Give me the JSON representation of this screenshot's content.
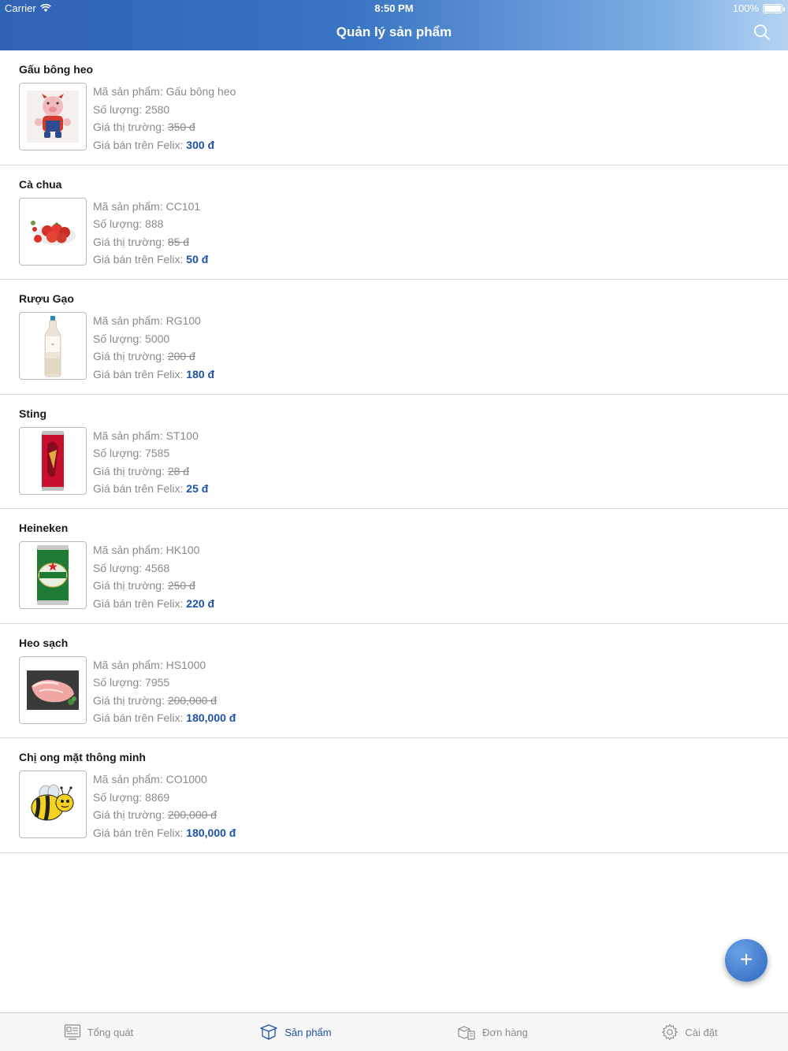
{
  "status_bar": {
    "carrier": "Carrier",
    "time": "8:50 PM",
    "battery": "100%"
  },
  "header": {
    "title": "Quản lý sản phẩm",
    "search_icon": "search-icon"
  },
  "labels": {
    "code": "Mã sản phẩm: ",
    "qty": "Số lượng: ",
    "market": "Giá thị trường: ",
    "felix": "Giá bán trên Felix: "
  },
  "products": [
    {
      "name": "Gấu bông heo",
      "code": "Gấu bông heo",
      "qty": "2580",
      "market_price": "350 đ",
      "felix_price": "300 đ",
      "image": "pig-plush-image"
    },
    {
      "name": "Cà chua",
      "code": "CC101",
      "qty": "888",
      "market_price": "85 đ",
      "felix_price": "50 đ",
      "image": "tomato-image"
    },
    {
      "name": "Rượu Gạo",
      "code": "RG100",
      "qty": "5000",
      "market_price": "200 đ",
      "felix_price": "180 đ",
      "image": "rice-wine-bottle-image"
    },
    {
      "name": "Sting",
      "code": "ST100",
      "qty": "7585",
      "market_price": "28 đ",
      "felix_price": "25 đ",
      "image": "sting-can-image"
    },
    {
      "name": "Heineken",
      "code": "HK100",
      "qty": "4568",
      "market_price": "250 đ",
      "felix_price": "220 đ",
      "image": "heineken-can-image"
    },
    {
      "name": "Heo sạch",
      "code": "HS1000",
      "qty": "7955",
      "market_price": "200,000 đ",
      "felix_price": "180,000 đ",
      "image": "pork-meat-image"
    },
    {
      "name": "Chị ong mặt thông minh",
      "code": "CO1000",
      "qty": "8869",
      "market_price": "200,000 đ",
      "felix_price": "180,000 đ",
      "image": "bee-cartoon-image"
    }
  ],
  "fab": {
    "label": "+",
    "icon": "plus-icon"
  },
  "tabs": [
    {
      "label": "Tổng quát",
      "icon": "overview-icon",
      "active": false
    },
    {
      "label": "Sản phẩm",
      "icon": "product-box-icon",
      "active": true
    },
    {
      "label": "Đơn hàng",
      "icon": "orders-icon",
      "active": false
    },
    {
      "label": "Cài đặt",
      "icon": "settings-gear-icon",
      "active": false
    }
  ],
  "colors": {
    "header_start": "#2f63b3",
    "header_end": "#b4d3f2",
    "accent": "#1d52a8",
    "muted_text": "#8a8a8a"
  }
}
